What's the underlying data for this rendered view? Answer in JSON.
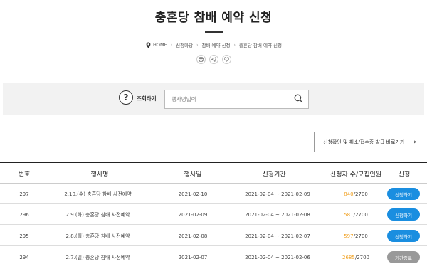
{
  "header": {
    "title": "충혼당 참배 예약 신청",
    "breadcrumb": [
      "HOME",
      "신청마당",
      "참배 예약 신청",
      "충혼당 참배 예약 신청"
    ]
  },
  "search": {
    "label": "조회하기",
    "help_symbol": "?",
    "placeholder": "행사명입력"
  },
  "link_button": {
    "label": "신청확인 및 취소/접수증 발급 바로가기",
    "arrow": "›"
  },
  "table": {
    "headers": [
      "번호",
      "행사명",
      "행사일",
      "신청기간",
      "신청자 수/모집인원",
      "신청"
    ],
    "rows": [
      {
        "no": "297",
        "name": "2.10.(수) 충혼당 참배 사전예약",
        "date": "2021-02-10",
        "period": "2021-02-04 ~ 2021-02-09",
        "count": "840",
        "capacity": "/2700",
        "action": "신청하기",
        "status": "open"
      },
      {
        "no": "296",
        "name": "2.9.(화) 충혼당 참배 사전예약",
        "date": "2021-02-09",
        "period": "2021-02-04 ~ 2021-02-08",
        "count": "581",
        "capacity": "/2700",
        "action": "신청하기",
        "status": "open"
      },
      {
        "no": "295",
        "name": "2.8.(월) 충혼당 참배 사전예약",
        "date": "2021-02-08",
        "period": "2021-02-04 ~ 2021-02-07",
        "count": "597",
        "capacity": "/2700",
        "action": "신청하기",
        "status": "open"
      },
      {
        "no": "294",
        "name": "2.7.(일) 충혼당 참배 사전예약",
        "date": "2021-02-07",
        "period": "2021-02-04 ~ 2021-02-06",
        "count": "2685",
        "capacity": "/2700",
        "action": "기간종료",
        "status": "closed"
      }
    ]
  },
  "colors": {
    "accent": "#1a8ee0",
    "count": "#f0a020",
    "closed": "#999999"
  },
  "icons": [
    "location-pin-icon",
    "print-icon",
    "send-icon",
    "heart-icon",
    "search-icon",
    "chevron-right-icon"
  ]
}
